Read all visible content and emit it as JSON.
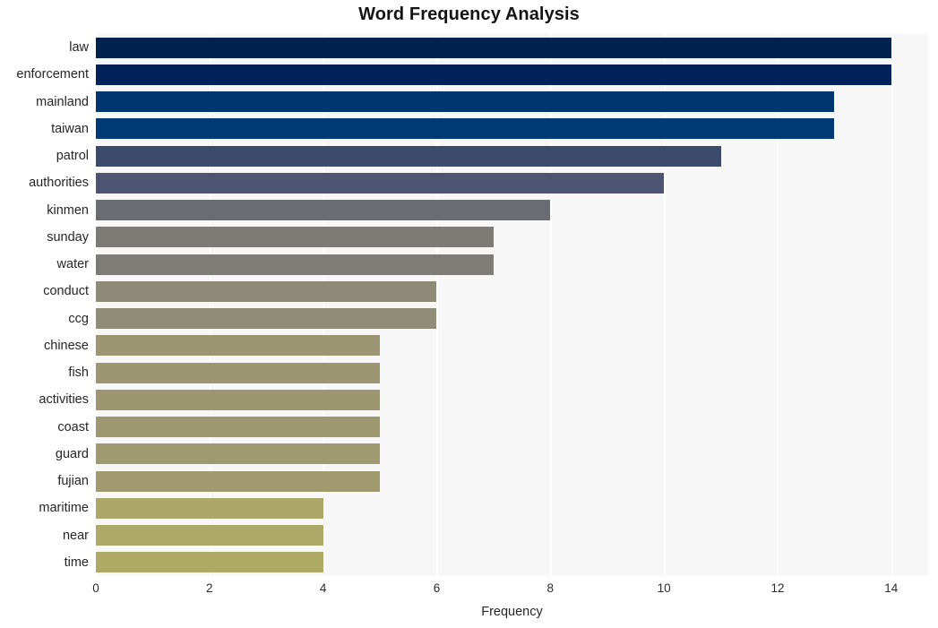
{
  "chart_data": {
    "type": "bar",
    "orientation": "horizontal",
    "title": "Word Frequency Analysis",
    "xlabel": "Frequency",
    "ylabel": "",
    "xlim": [
      0,
      14.65
    ],
    "xticks": [
      "0",
      "2",
      "4",
      "6",
      "8",
      "10",
      "12",
      "14"
    ],
    "xtick_values": [
      0,
      2,
      4,
      6,
      8,
      10,
      12,
      14
    ],
    "grid": "vertical-white",
    "legend": "none",
    "categories": [
      "law",
      "enforcement",
      "mainland",
      "taiwan",
      "patrol",
      "authorities",
      "kinmen",
      "sunday",
      "water",
      "conduct",
      "ccg",
      "chinese",
      "fish",
      "activities",
      "coast",
      "guard",
      "fujian",
      "maritime",
      "near",
      "time"
    ],
    "values": [
      14,
      14,
      13,
      13,
      11,
      10,
      8,
      7,
      7,
      6,
      6,
      5,
      5,
      5,
      5,
      5,
      5,
      4,
      4,
      4
    ],
    "bar_colors": [
      "#00224e",
      "#022259",
      "#003570",
      "#003a75",
      "#3c4a६b",
      "#4f5473",
      "#6b6c73",
      "#7c7b76",
      "#7d7c76",
      "#8d8a77",
      "#8f8c78",
      "#9b9573",
      "#9c9672",
      "#9d9771",
      "#9e9870",
      "#9f996f",
      "#a09a6e",
      "#aca86a",
      "#ada968",
      "#aeaa66"
    ],
    "plot_background": "#f7f7f7",
    "figure_background": "#ffffff"
  },
  "colors": {
    "accent": "#00224e",
    "tail": "#aeaa66",
    "plot_bg": "#f7f7f7",
    "grid": "#ffffff",
    "text": "#262626"
  }
}
